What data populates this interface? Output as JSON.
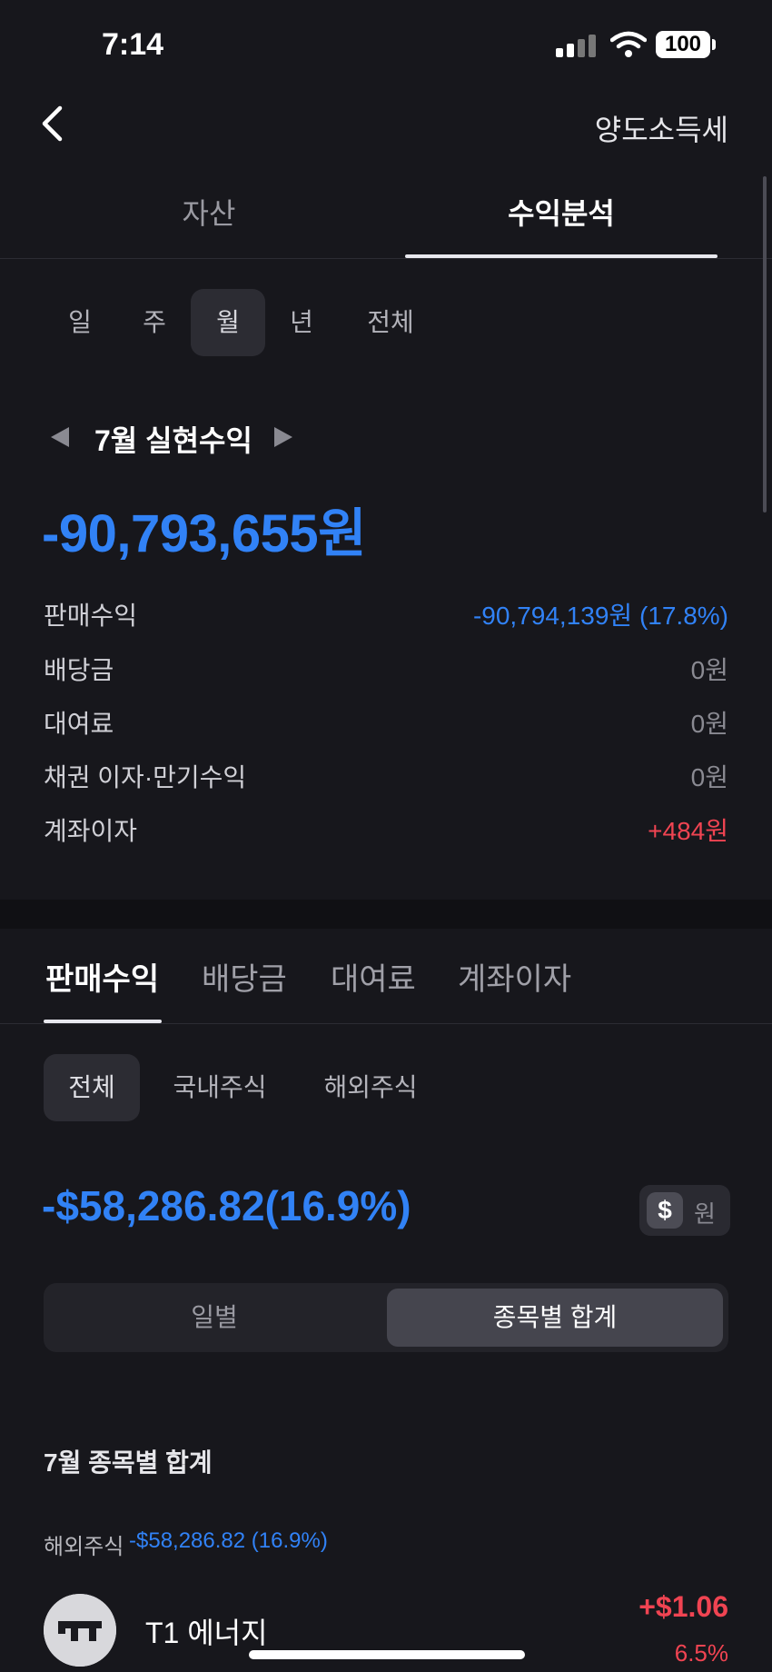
{
  "status_bar": {
    "time": "7:14",
    "battery": "100"
  },
  "nav": {
    "title": "양도소득세"
  },
  "tabs": {
    "assets": "자산",
    "analysis": "수익분석"
  },
  "periods": [
    "일",
    "주",
    "월",
    "년",
    "전체"
  ],
  "realized": {
    "label": "7월 실현수익",
    "total": "-90,793,655원",
    "rows": [
      {
        "label": "판매수익",
        "value": "-90,794,139원 (17.8%)"
      },
      {
        "label": "배당금",
        "value": "0원"
      },
      {
        "label": "대여료",
        "value": "0원"
      },
      {
        "label": "채권 이자·만기수익",
        "value": "0원"
      },
      {
        "label": "계좌이자",
        "value": "+484원"
      }
    ]
  },
  "sub_tabs": [
    "판매수익",
    "배당금",
    "대여료",
    "계좌이자"
  ],
  "filters": [
    "전체",
    "국내주식",
    "해외주식"
  ],
  "summary": {
    "value": "-$58,286.82(16.9%)",
    "currency_usd": "$",
    "currency_krw": "원"
  },
  "segment": {
    "daily": "일별",
    "by_stock": "종목별 합계"
  },
  "by_stock": {
    "heading": "7월 종목별 합계",
    "group_label": "해외주식",
    "group_value": "-$58,286.82 (16.9%)",
    "items": [
      {
        "name": "T1 에너지",
        "profit": "+$1.06",
        "rate": "6.5%"
      }
    ]
  },
  "colors": {
    "loss_blue": "#3182f6",
    "gain_red": "#f04452",
    "background": "#17171c"
  }
}
